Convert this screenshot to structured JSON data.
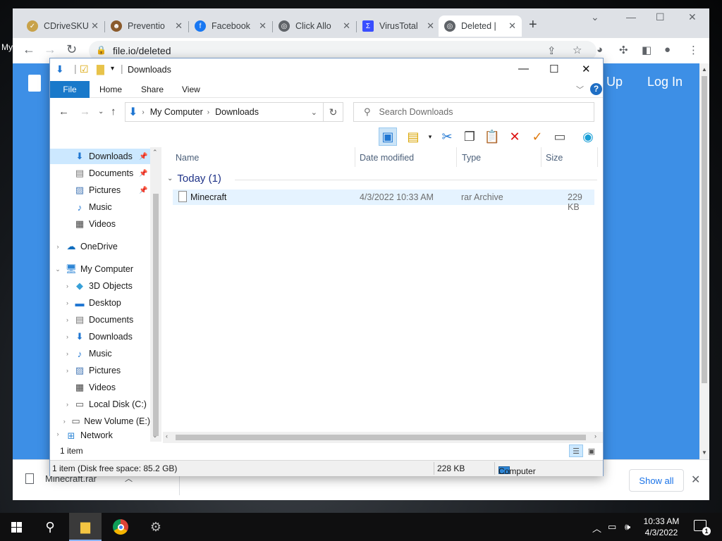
{
  "desktop": {
    "label": "My"
  },
  "browser": {
    "tabs": [
      {
        "title": "CDriveSKU",
        "fav_color": "#c8a24a"
      },
      {
        "title": "Preventio",
        "fav_color": "#8a5a2b"
      },
      {
        "title": "Facebook",
        "fav_color": "#1877f2"
      },
      {
        "title": "Click Allo",
        "fav_color": "#5f6368"
      },
      {
        "title": "VirusTotal",
        "fav_color": "#394eff"
      },
      {
        "title": "Deleted |",
        "fav_color": "#5f6368"
      }
    ],
    "url": "file.io/deleted",
    "page": {
      "signup_label": "Up",
      "login_label": "Log In",
      "bg_color": "#3d8fe6"
    },
    "download_shelf": {
      "file_name": "Minecraft.rar",
      "show_all_label": "Show all"
    }
  },
  "explorer": {
    "title": "Downloads",
    "ribbon_tabs": [
      "File",
      "Home",
      "Share",
      "View"
    ],
    "breadcrumb": [
      "My Computer",
      "Downloads"
    ],
    "search_placeholder": "Search Downloads",
    "nav_items": [
      {
        "label": "Downloads",
        "icon": "download-arrow-icon",
        "pinned": true
      },
      {
        "label": "Documents",
        "icon": "document-icon",
        "pinned": true
      },
      {
        "label": "Pictures",
        "icon": "picture-icon",
        "pinned": true
      },
      {
        "label": "Music",
        "icon": "music-note-icon",
        "pinned": false
      },
      {
        "label": "Videos",
        "icon": "film-icon",
        "pinned": false
      },
      {
        "label": "OneDrive",
        "icon": "cloud-icon",
        "pinned": false
      },
      {
        "label": "My Computer",
        "icon": "computer-icon",
        "pinned": false
      },
      {
        "label": "3D Objects",
        "icon": "cube-icon",
        "pinned": false
      },
      {
        "label": "Desktop",
        "icon": "desktop-icon",
        "pinned": false
      },
      {
        "label": "Documents",
        "icon": "document-icon",
        "pinned": false
      },
      {
        "label": "Downloads",
        "icon": "download-arrow-icon",
        "pinned": false
      },
      {
        "label": "Music",
        "icon": "music-note-icon",
        "pinned": false
      },
      {
        "label": "Pictures",
        "icon": "picture-icon",
        "pinned": false
      },
      {
        "label": "Videos",
        "icon": "film-icon",
        "pinned": false
      },
      {
        "label": "Local Disk (C:)",
        "icon": "drive-icon",
        "pinned": false
      },
      {
        "label": "New Volume (E:)",
        "icon": "drive-icon",
        "pinned": false
      },
      {
        "label": "Network",
        "icon": "network-icon",
        "pinned": false
      }
    ],
    "columns": [
      "Name",
      "Date modified",
      "Type",
      "Size"
    ],
    "group": {
      "label": "Today (1)"
    },
    "files": [
      {
        "name": "Minecraft",
        "date": "4/3/2022 10:33 AM",
        "type": "rar Archive",
        "size": "229 KB"
      }
    ],
    "item_count": "1 item",
    "status": {
      "summary": "1 item (Disk free space: 85.2 GB)",
      "size": "228 KB",
      "location": "Computer"
    }
  },
  "taskbar": {
    "time": "10:33 AM",
    "date": "4/3/2022",
    "notification_count": "1"
  }
}
